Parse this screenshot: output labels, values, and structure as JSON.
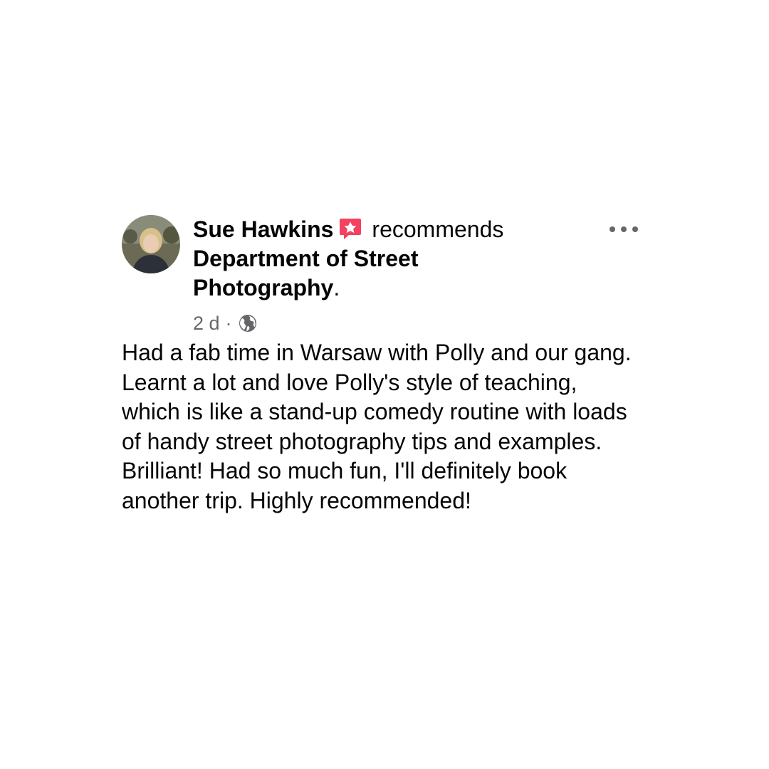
{
  "post": {
    "author": "Sue Hawkins",
    "verb": "recommends",
    "page": "Department of Street Photography",
    "period": ".",
    "timestamp": "2 d",
    "separator": "·",
    "audience_icon": "globe-icon",
    "recommend_icon": "recommend-star-icon",
    "more_icon": "more-options-icon",
    "text": "Had a fab time in Warsaw with Polly and our gang. Learnt a lot and love Polly's style of teaching, which is like a stand-up comedy routine with loads of handy street photography tips and examples. Brilliant! Had so much fun, I'll definitely book another trip. Highly recommended!"
  },
  "colors": {
    "recommend_badge": "#f3425f",
    "meta_text": "#65676b",
    "primary_text": "#050505"
  }
}
